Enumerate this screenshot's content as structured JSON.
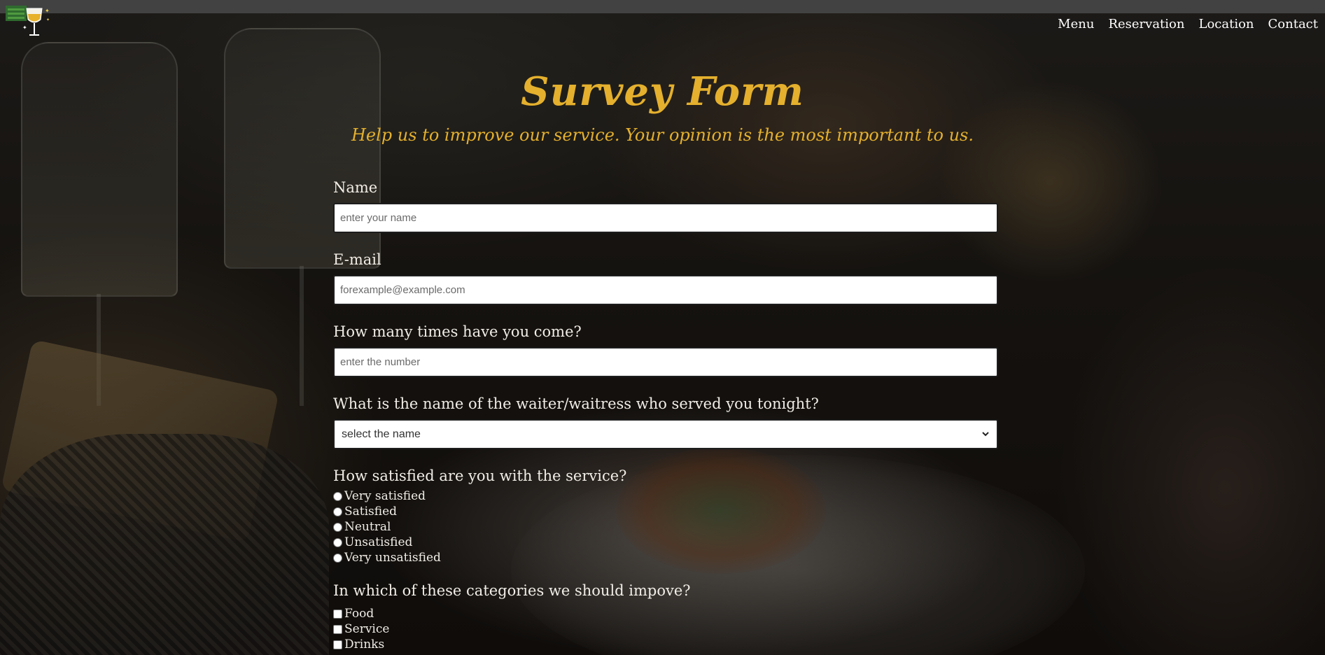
{
  "nav": {
    "items": [
      {
        "label": "Menu"
      },
      {
        "label": "Reservation"
      },
      {
        "label": "Location"
      },
      {
        "label": "Contact"
      }
    ]
  },
  "header": {
    "title": "Survey Form",
    "subtitle": "Help us to improve our service. Your opinion is the most important to us."
  },
  "form": {
    "name": {
      "label": "Name",
      "placeholder": "enter your name"
    },
    "email": {
      "label": "E-mail",
      "placeholder": "forexample@example.com"
    },
    "visits": {
      "label": "How many times have you come?",
      "placeholder": "enter the number"
    },
    "waiter": {
      "label": "What is the name of the waiter/waitress who served you tonight?",
      "selected": "select the name"
    },
    "satisfaction": {
      "label": "How satisfied are you with the service?",
      "options": [
        "Very satisfied",
        "Satisfied",
        "Neutral",
        "Unsatisfied",
        "Very unsatisfied"
      ]
    },
    "improve": {
      "label": "In which of these categories we should impove?",
      "options": [
        "Food",
        "Service",
        "Drinks"
      ]
    }
  },
  "colors": {
    "accent": "#e4b02d",
    "topbar": "#424242",
    "logo_bars": "#2f6b2f"
  }
}
